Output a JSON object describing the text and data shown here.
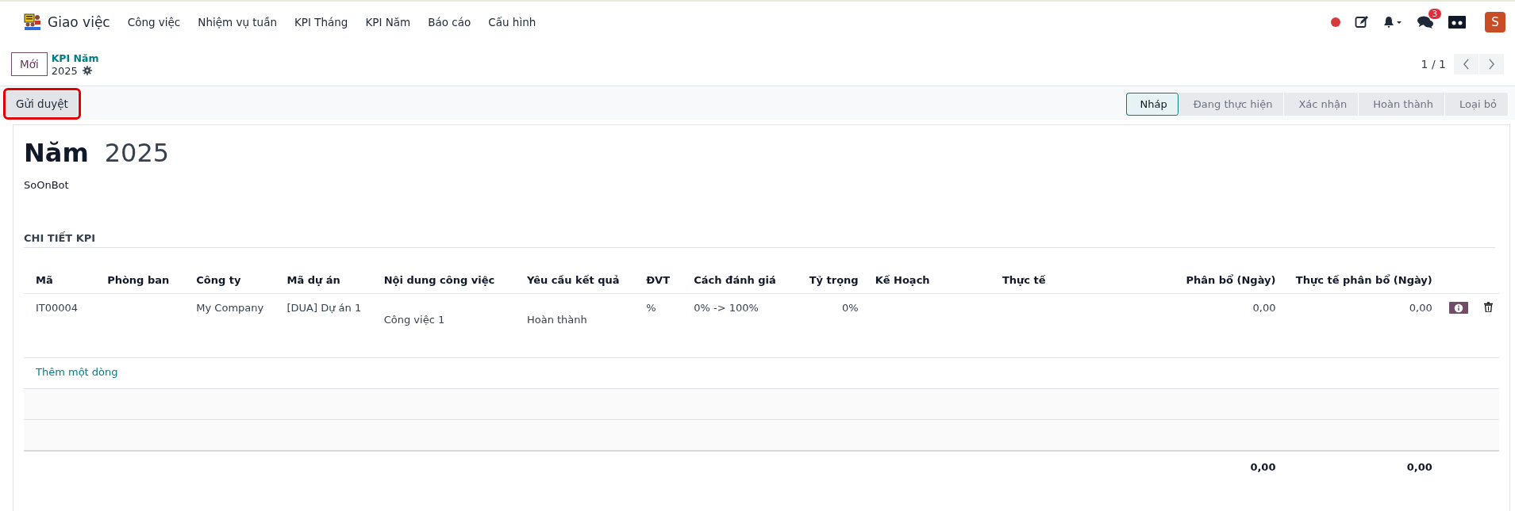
{
  "navbar": {
    "app_name": "Giao việc",
    "menu": [
      "Công việc",
      "Nhiệm vụ tuần",
      "KPI Tháng",
      "KPI Năm",
      "Báo cáo",
      "Cấu hình"
    ],
    "message_badge": "3",
    "avatar": "S"
  },
  "control_panel": {
    "new_button": "Mới",
    "breadcrumb": "KPI Năm",
    "record": "2025",
    "pager": "1 / 1"
  },
  "action_button": {
    "label": "Gửi duyệt",
    "highlighted": true
  },
  "stages": [
    {
      "label": "Nháp",
      "selected": true
    },
    {
      "label": "Đang thực hiện",
      "selected": false
    },
    {
      "label": "Xác nhận",
      "selected": false
    },
    {
      "label": "Hoàn thành",
      "selected": false
    },
    {
      "label": "Loại bỏ",
      "selected": false
    }
  ],
  "form": {
    "title_label": "Năm",
    "title_value": "2025",
    "user": "SoOnBot",
    "section": "CHI TIẾT KPI"
  },
  "table": {
    "columns": [
      "Mã",
      "Phòng ban",
      "Công ty",
      "Mã dự án",
      "Nội dung công việc",
      "Yêu cầu kết quả",
      "ĐVT",
      "Cách đánh giá",
      "Tỷ trọng",
      "Kế Hoạch",
      "Thực tế",
      "Phân bổ (Ngày)",
      "Thực tế phân bổ (Ngày)"
    ],
    "rows": [
      {
        "code": "IT00004",
        "company": "My Company",
        "project": "[DUA] Dự án 1",
        "task": "Công việc 1",
        "result": "Hoàn thành",
        "unit": "%",
        "evaluation": "0% -> 100%",
        "weight": "0%",
        "allocated": "0,00",
        "actual_allocated": "0,00"
      }
    ],
    "add_line": "Thêm một dòng",
    "totals": {
      "allocated": "0,00",
      "actual_allocated": "0,00"
    }
  }
}
